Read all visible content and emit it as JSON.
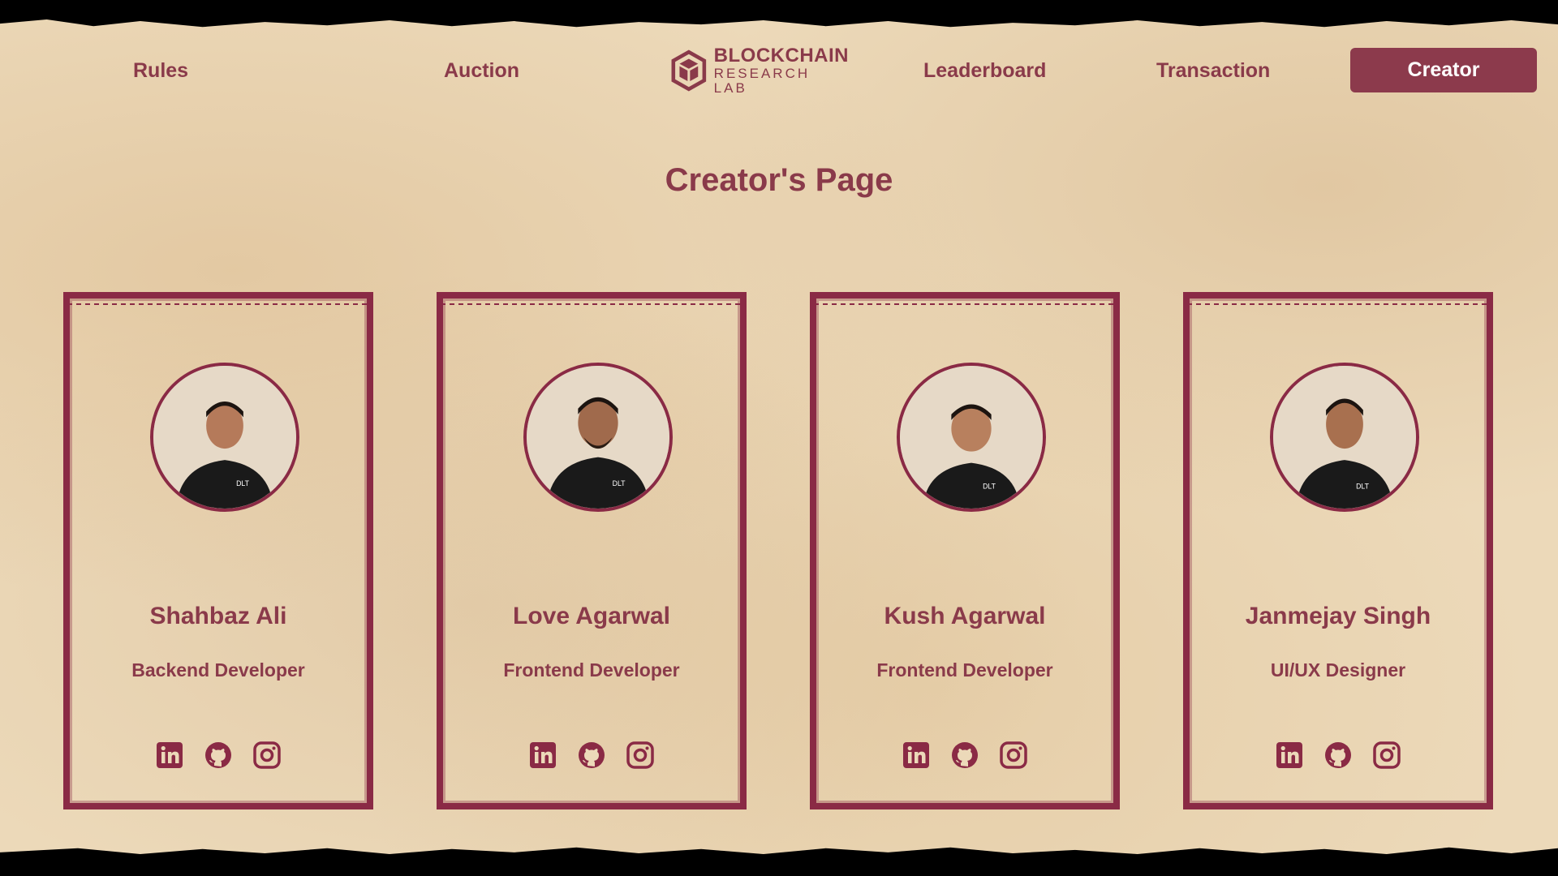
{
  "nav": {
    "rules": "Rules",
    "auction": "Auction",
    "leaderboard": "Leaderboard",
    "transaction": "Transaction",
    "creator": "Creator"
  },
  "logo": {
    "top": "BLOCKCHAIN",
    "bottom": "RESEARCH LAB"
  },
  "page_title": "Creator's Page",
  "creators": [
    {
      "name": "Shahbaz Ali",
      "role": "Backend Developer"
    },
    {
      "name": "Love Agarwal",
      "role": "Frontend Developer"
    },
    {
      "name": "Kush Agarwal",
      "role": "Frontend Developer"
    },
    {
      "name": "Janmejay Singh",
      "role": "UI/UX Designer"
    }
  ],
  "social_icons": [
    "linkedin-icon",
    "github-icon",
    "instagram-icon"
  ],
  "colors": {
    "accent": "#8a3a4a",
    "border": "#8a2a45",
    "button": "#8c3a4c",
    "paper": "#ecd9b9"
  }
}
